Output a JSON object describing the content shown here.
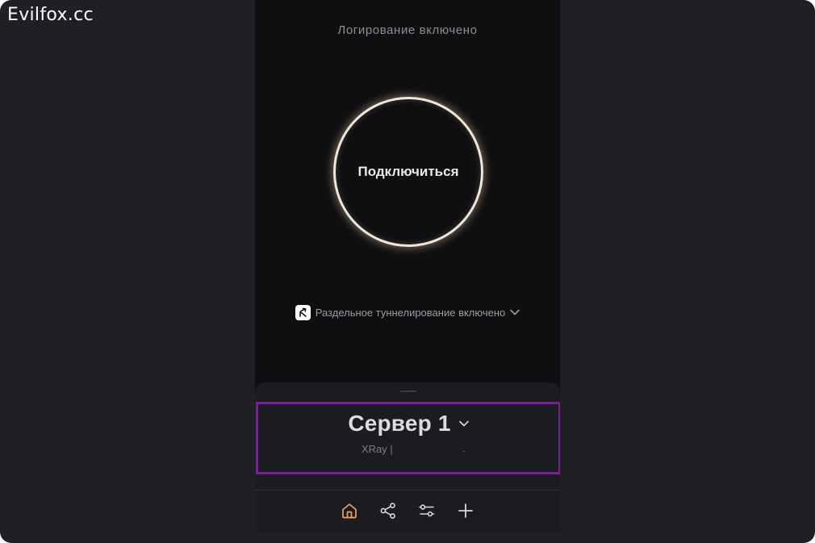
{
  "watermark": "Evilfox.cc",
  "status": {
    "logging": "Логирование включено"
  },
  "connect": {
    "label": "Подключиться",
    "ring_color": "#efe6dc"
  },
  "split_tunneling": {
    "label": "Раздельное туннелирование включено",
    "icon": "split-arrow-icon"
  },
  "server": {
    "name": "Сервер 1",
    "protocol": "XRay |",
    "highlight_color": "#7b1f96"
  },
  "tabbar": {
    "items": [
      {
        "icon": "home-icon",
        "active": true,
        "color": "#f0a35e"
      },
      {
        "icon": "share-icon",
        "active": false,
        "color": "#d8d8dc"
      },
      {
        "icon": "sliders-icon",
        "active": false,
        "color": "#d8d8dc"
      },
      {
        "icon": "plus-icon",
        "active": false,
        "color": "#d8d8dc"
      }
    ]
  }
}
